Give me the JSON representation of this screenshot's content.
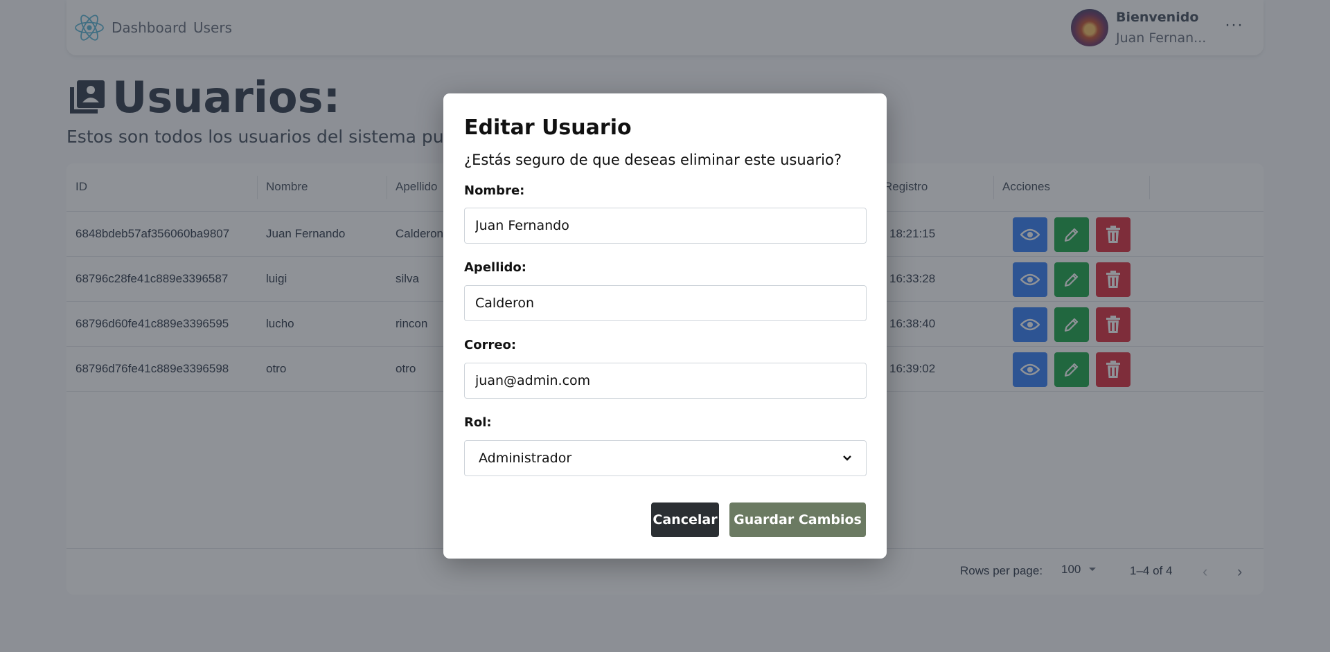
{
  "navbar": {
    "links": [
      "Dashboard",
      "Users"
    ],
    "welcome_title": "Bienvenido",
    "welcome_name": "Juan Fernan...",
    "more_label": "···"
  },
  "page": {
    "title": "Usuarios:",
    "subtitle": "Estos son todos los usuarios del sistema puedes e"
  },
  "table": {
    "columns": [
      "ID",
      "Nombre",
      "Apellido",
      "Registro",
      "Acciones"
    ],
    "rows": [
      {
        "id": "6848bdeb57af356060ba9807",
        "nombre": "Juan Fernando",
        "apellido": "Calderon",
        "registro": "18:21:15"
      },
      {
        "id": "68796c28fe41c889e3396587",
        "nombre": "luigi",
        "apellido": "silva",
        "registro": "16:33:28"
      },
      {
        "id": "68796d60fe41c889e3396595",
        "nombre": "lucho",
        "apellido": "rincon",
        "registro": "16:38:40"
      },
      {
        "id": "68796d76fe41c889e3396598",
        "nombre": "otro",
        "apellido": "otro",
        "registro": "16:39:02"
      }
    ],
    "footer": {
      "rows_per_page_label": "Rows per page:",
      "rows_per_page_value": "100",
      "range": "1–4 of 4"
    }
  },
  "modal": {
    "title": "Editar Usuario",
    "message": "¿Estás seguro de que deseas eliminar este usuario?",
    "fields": {
      "nombre_label": "Nombre:",
      "nombre_value": "Juan Fernando",
      "apellido_label": "Apellido:",
      "apellido_value": "Calderon",
      "correo_label": "Correo:",
      "correo_value": "juan@admin.com",
      "rol_label": "Rol:",
      "rol_value": "Administrador"
    },
    "cancel_label": "Cancelar",
    "save_label": "Guardar Cambios"
  },
  "colors": {
    "view": "#3b82f6",
    "edit": "#22a94f",
    "delete": "#dc3545",
    "save": "#6b7a62",
    "cancel": "#2b2f33"
  }
}
